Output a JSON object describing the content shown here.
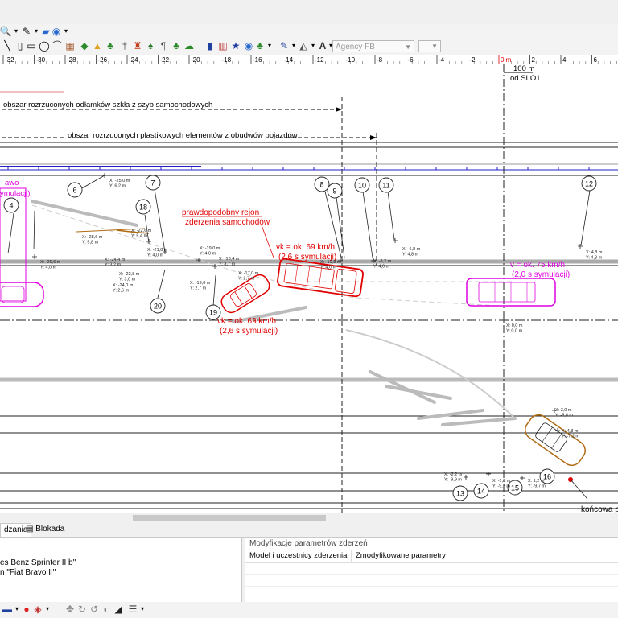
{
  "toolbar": {
    "font_name": "Agency FB",
    "font_size": ""
  },
  "ruler": {
    "ticks": [
      "-32",
      "-30",
      "-28",
      "-26",
      "-24",
      "-22",
      "-20",
      "-18",
      "-16",
      "-14",
      "-12",
      "-10",
      "-8",
      "-6",
      "-4",
      "-2",
      "0 m",
      "2",
      "4",
      "6"
    ],
    "zero_color": "#e00000"
  },
  "scale": {
    "distance": "100 m",
    "reference": "od SLO1"
  },
  "annotations": {
    "glass_zone": "obszar rozrzuconych odłamków szkła z szyb samochodowych",
    "plastic_zone": "obszar rozrzuconych plastikowych elementów z obudwów pojazdów",
    "collision_line1": "prawdopodobny rejon",
    "collision_line2": "zderzenia samochodów",
    "speed_sprinter_1": "vk = ok. 69 km/h",
    "speed_sprinter_2": "(2,6 s symulacji)",
    "speed_fiat_1": "vk = ok. 69 km/h",
    "speed_fiat_2": "(2,6 s symulacji)",
    "speed_initial_1": "v = ok. 75 km/h",
    "speed_initial_2": "(2,0 s symulacji)",
    "left_pink_1": "awo",
    "left_pink_2": "ymulacji)",
    "final_position": "końcowa p"
  },
  "markers": [
    {
      "id": "4"
    },
    {
      "id": "6"
    },
    {
      "id": "7"
    },
    {
      "id": "8"
    },
    {
      "id": "9"
    },
    {
      "id": "10"
    },
    {
      "id": "11"
    },
    {
      "id": "12"
    },
    {
      "id": "13"
    },
    {
      "id": "14"
    },
    {
      "id": "15"
    },
    {
      "id": "16"
    },
    {
      "id": "18"
    },
    {
      "id": "19"
    },
    {
      "id": "20"
    }
  ],
  "coords": [
    {
      "x": "X: -25,0 m",
      "y": "Y: 6,2 m"
    },
    {
      "x": "X: -28,6 m",
      "y": "Y: 5,8 m"
    },
    {
      "x": "X: -22,6 m",
      "y": "Y: 5,4 m"
    },
    {
      "x": "X: -24,4 m",
      "y": "Y: 3,2 m"
    },
    {
      "x": "X: -21,8 m",
      "y": "Y: 4,0 m"
    },
    {
      "x": "X: -22,8 m",
      "y": "Y: 3,0 m"
    },
    {
      "x": "X: -24,0 m",
      "y": "Y: 2,6 m"
    },
    {
      "x": "X: -29,6 m",
      "y": "Y: 4,0 m"
    },
    {
      "x": "X: -19,0 m",
      "y": "Y: 4,0 m"
    },
    {
      "x": "X: -18,4 m",
      "y": "Y: 3,7 m"
    },
    {
      "x": "X: -19,0 m",
      "y": "Y: 2,7 m"
    },
    {
      "x": "X: -17,0 m",
      "y": "Y: 2,7 m"
    },
    {
      "x": "X: -10,8 m",
      "y": "Y: 4,0 m"
    },
    {
      "x": "X: -8,2 m",
      "y": "Y: 4,0 m"
    },
    {
      "x": "X: -6,8 m",
      "y": "Y: 4,8 m"
    },
    {
      "x": "X: 4,8 m",
      "y": "Y: 4,8 m"
    },
    {
      "x": "X: 0,0 m",
      "y": "Y: 0,0 m"
    },
    {
      "x": "X: 3,0 m",
      "y": "Y: -5,8 m"
    },
    {
      "x": "X: 4,8 m",
      "y": "Y: -7,2 m"
    },
    {
      "x": "X: -2,2 m",
      "y": "Y: -9,9 m"
    },
    {
      "x": "X: -1,0 m",
      "y": "Y: -9,7 m"
    },
    {
      "x": "X: 1,2 m",
      "y": "Y: -9,7 m"
    }
  ],
  "tabs": {
    "active": "dzania",
    "second": "Blokada"
  },
  "left_panel": {
    "rows": [
      "es Benz Sprinter II b\"",
      "n \"Fiat Bravo II\""
    ]
  },
  "right_panel": {
    "title": "Modyfikacje parametrów zderzeń",
    "col1": "Model i uczestnicy zderzenia",
    "col2": "Zmodyfikowane parametry"
  },
  "colors": {
    "accent_red": "#e00000",
    "accent_magenta": "#e000e0",
    "lane_blue": "#2020c8",
    "path_brown": "#b06a10"
  }
}
